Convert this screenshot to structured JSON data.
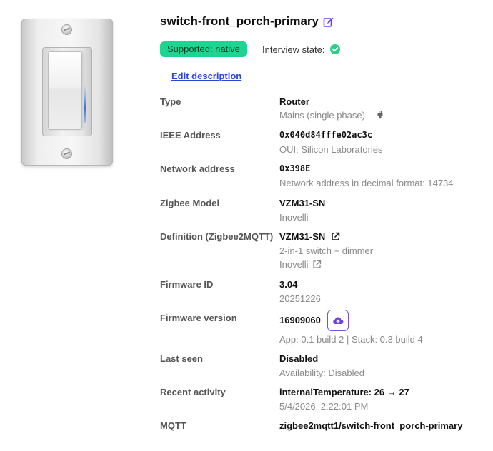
{
  "device": {
    "title": "switch-front_porch-primary",
    "icons": {
      "edit": "edit-icon",
      "interview": "check-circle-icon"
    }
  },
  "status": {
    "supported": "Supported: native",
    "interview_label": "Interview state:"
  },
  "edit_description": "Edit description",
  "details": {
    "type": {
      "label": "Type",
      "value": "Router",
      "sub": "Mains (single phase)",
      "icon": "plug-icon"
    },
    "ieee": {
      "label": "IEEE Address",
      "value": "0x040d84fffe02ac3c",
      "sub": "OUI: Silicon Laboratories"
    },
    "network": {
      "label": "Network address",
      "value": "0x398E",
      "sub": "Network address in decimal format: 14734"
    },
    "model": {
      "label": "Zigbee Model",
      "value": "VZM31-SN",
      "sub": "Inovelli"
    },
    "definition": {
      "label": "Definition (Zigbee2MQTT)",
      "value": "VZM31-SN",
      "sub": "2-in-1 switch + dimmer",
      "vendor": "Inovelli",
      "icon": "external-link-icon"
    },
    "firmware_id": {
      "label": "Firmware ID",
      "value": "3.04",
      "sub": "20251226"
    },
    "firmware_version": {
      "label": "Firmware version",
      "value": "16909060",
      "sub": "App: 0.1 build 2 | Stack: 0.3 build 4",
      "icon": "cloud-upload-icon"
    },
    "last_seen": {
      "label": "Last seen",
      "value": "Disabled",
      "sub": "Availability: Disabled"
    },
    "recent_activity": {
      "label": "Recent activity",
      "value": "internalTemperature: 26 → 27",
      "sub": "5/4/2026, 2:22:01 PM"
    },
    "mqtt": {
      "label": "MQTT",
      "value": "zigbee2mqtt1/switch-front_porch-primary"
    }
  },
  "colors": {
    "accent": "#2a46d8",
    "badge": "#1ed490",
    "primary_purple": "#6f3fe0"
  }
}
